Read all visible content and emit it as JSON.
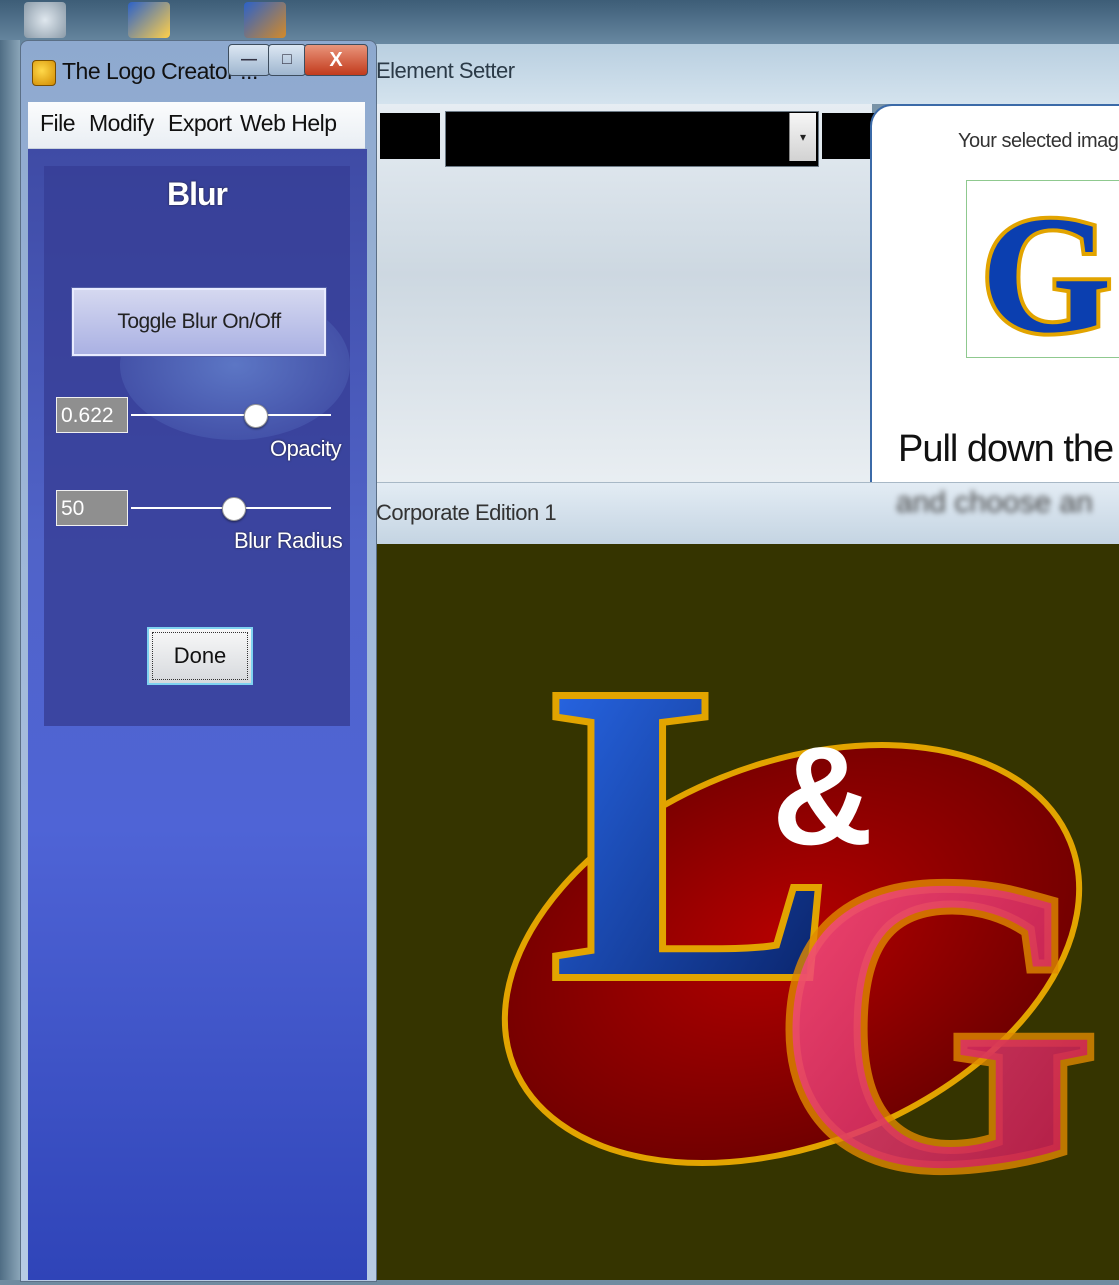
{
  "tool_window": {
    "title": "The Logo Creator ...",
    "controls": {
      "minimize": "—",
      "maximize": "□",
      "close": "X"
    },
    "menu": [
      "File",
      "Modify",
      "Export",
      "Web Help"
    ],
    "panel": {
      "title": "Blur",
      "toggle_button": "Toggle Blur On/Off",
      "opacity": {
        "value": "0.622",
        "label": "Opacity",
        "level": 0.622
      },
      "blur_radius": {
        "value": "50",
        "label": "Blur Radius",
        "level": 0.5
      },
      "done_button": "Done"
    }
  },
  "background_window": {
    "title": "Element Setter",
    "selected_image_label": "Your selected imag",
    "selected_image_letter": "G",
    "pull_down_text": "Pull down the r",
    "blurred_text": "and choose an",
    "status_text": "Corporate Edition 1",
    "combo_arrow": "▾"
  },
  "canvas_logo": {
    "letters": [
      "L",
      "&",
      "G"
    ],
    "colors": {
      "background": "#353400",
      "oval": "#a80000",
      "outline": "#e2a400",
      "l_fill": "#0a3fb8",
      "g_fill": "#e83070"
    }
  }
}
